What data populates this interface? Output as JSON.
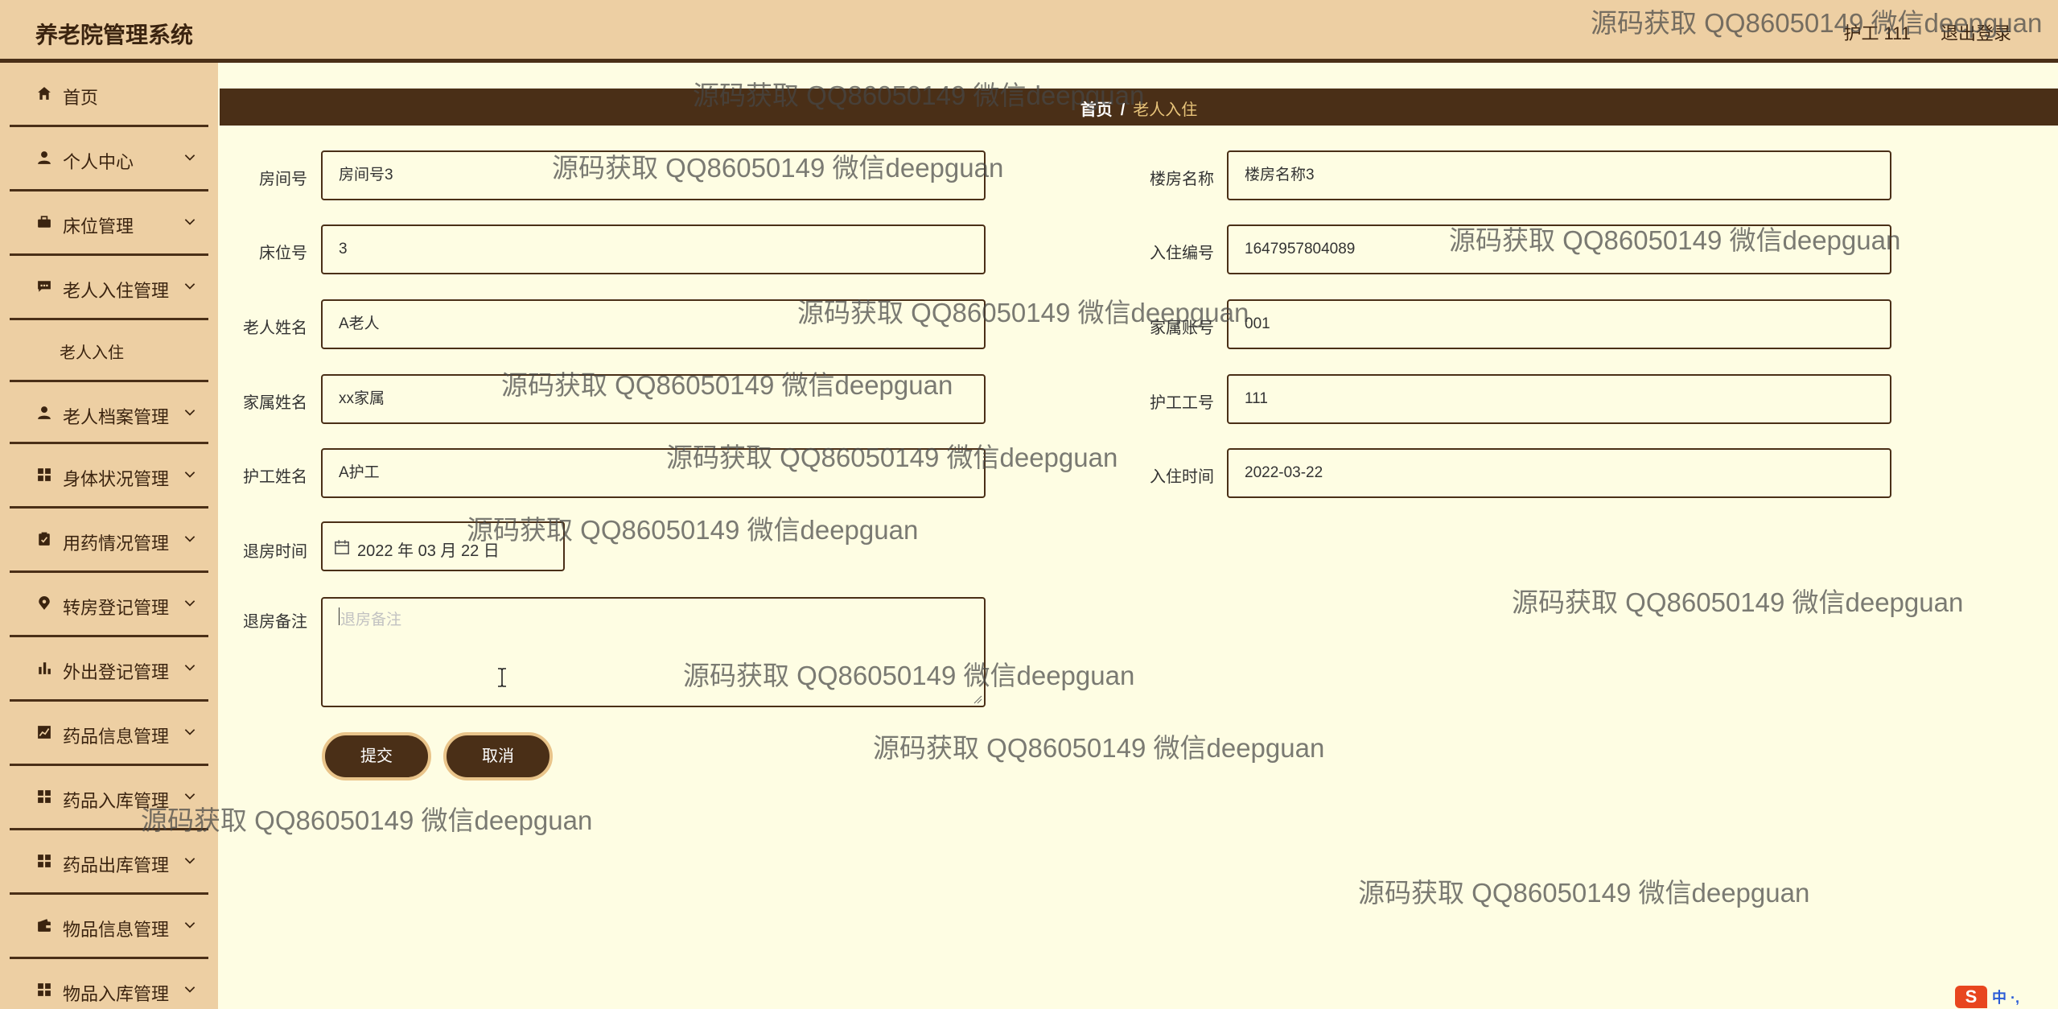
{
  "header": {
    "app_title": "养老院管理系统",
    "user": "护工 111",
    "logout": "退出登录"
  },
  "sidebar": {
    "items": [
      {
        "label": "首页",
        "icon": "home-icon"
      },
      {
        "label": "个人中心",
        "icon": "user-icon"
      },
      {
        "label": "床位管理",
        "icon": "bed-icon"
      },
      {
        "label": "老人入住管理",
        "icon": "chat-icon"
      },
      {
        "label": "老人档案管理",
        "icon": "user-icon"
      },
      {
        "label": "身体状况管理",
        "icon": "grid-icon"
      },
      {
        "label": "用药情况管理",
        "icon": "clipboard-icon"
      },
      {
        "label": "转房登记管理",
        "icon": "location-icon"
      },
      {
        "label": "外出登记管理",
        "icon": "bar-chart-icon"
      },
      {
        "label": "药品信息管理",
        "icon": "chart-icon"
      },
      {
        "label": "药品入库管理",
        "icon": "grid-icon"
      },
      {
        "label": "药品出库管理",
        "icon": "grid-icon"
      },
      {
        "label": "物品信息管理",
        "icon": "wallet-icon"
      },
      {
        "label": "物品入库管理",
        "icon": "grid-icon"
      }
    ],
    "submenu": "老人入住"
  },
  "breadcrumb": {
    "home": "首页",
    "separator": "/",
    "current": "老人入住"
  },
  "form": {
    "room_no": {
      "label": "房间号",
      "value": "房间号3"
    },
    "building": {
      "label": "楼房名称",
      "value": "楼房名称3"
    },
    "bed_no": {
      "label": "床位号",
      "value": "3"
    },
    "checkin_no": {
      "label": "入住编号",
      "value": "1647957804089"
    },
    "elder_name": {
      "label": "老人姓名",
      "value": "A老人"
    },
    "family_account": {
      "label": "家属账号",
      "value": "001"
    },
    "family_name": {
      "label": "家属姓名",
      "value": "xx家属"
    },
    "nurse_id": {
      "label": "护工工号",
      "value": "111"
    },
    "nurse_name": {
      "label": "护工姓名",
      "value": "A护工"
    },
    "checkin_time": {
      "label": "入住时间",
      "value": "2022-03-22"
    },
    "checkout_time": {
      "label": "退房时间",
      "value": "2022 年 03 月 22 日"
    },
    "checkout_note": {
      "label": "退房备注",
      "placeholder": "退房备注"
    },
    "submit": "提交",
    "cancel": "取消"
  },
  "watermark": "源码获取 QQ86050149 微信deepguan",
  "ime": "中 ·,"
}
